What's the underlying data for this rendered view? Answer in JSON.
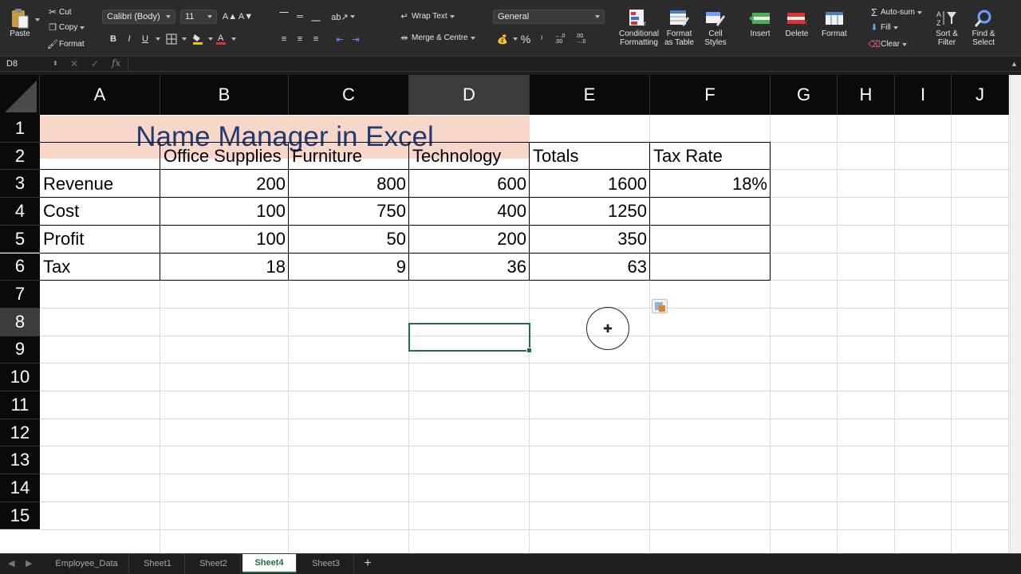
{
  "ribbon": {
    "clipboard": {
      "paste": "Paste",
      "cut": "Cut",
      "copy": "Copy",
      "format": "Format"
    },
    "font": {
      "name": "Calibri (Body)",
      "size": "11",
      "bold": "B",
      "italic": "I",
      "underline": "U"
    },
    "alignment": {
      "wrap_text": "Wrap Text",
      "merge_centre": "Merge & Centre"
    },
    "number": {
      "format": "General",
      "percent": "%",
      "inc_decimal": "←.0\n.00",
      "dec_decimal": ".00\n→.0"
    },
    "styles": {
      "conditional_formatting": "Conditional\nFormatting",
      "format_as_table": "Format\nas Table",
      "cell_styles": "Cell\nStyles"
    },
    "cells": {
      "insert": "Insert",
      "delete": "Delete",
      "format": "Format"
    },
    "editing": {
      "autosum": "Auto-sum",
      "fill": "Fill",
      "clear": "Clear",
      "sort_filter": "Sort &\nFilter",
      "find_select": "Find &\nSelect"
    }
  },
  "formula_bar": {
    "name_box": "D8",
    "fx": "fx",
    "value": ""
  },
  "columns": [
    "A",
    "B",
    "C",
    "D",
    "E",
    "F",
    "G",
    "H",
    "I",
    "J"
  ],
  "selected_column": "D",
  "rows": [
    "1",
    "2",
    "3",
    "4",
    "5",
    "6",
    "7",
    "8",
    "9",
    "10",
    "11",
    "12",
    "13",
    "14",
    "15"
  ],
  "selected_row": "8",
  "sheet": {
    "title": "Name Manager in Excel",
    "headers": [
      "",
      "Office Supplies",
      "Furniture",
      "Technology",
      "Totals",
      "Tax Rate"
    ],
    "data": [
      {
        "label": "Revenue",
        "values": [
          "200",
          "800",
          "600",
          "1600"
        ],
        "tax_rate": "18%"
      },
      {
        "label": "Cost",
        "values": [
          "100",
          "750",
          "400",
          "1250"
        ],
        "tax_rate": ""
      },
      {
        "label": "Profit",
        "values": [
          "100",
          "50",
          "200",
          "350"
        ],
        "tax_rate": ""
      },
      {
        "label": "Tax",
        "values": [
          "18",
          "9",
          "36",
          "63"
        ],
        "tax_rate": ""
      }
    ]
  },
  "tabs": {
    "items": [
      "Employee_Data",
      "Sheet1",
      "Sheet2",
      "Sheet4",
      "Sheet3"
    ],
    "active": "Sheet4",
    "add": "+"
  },
  "colors": {
    "accent": "#1f6f3f",
    "title_fill": "#f8d7c8",
    "title_text": "#213a73",
    "header_bg": "#0a0a0a"
  }
}
